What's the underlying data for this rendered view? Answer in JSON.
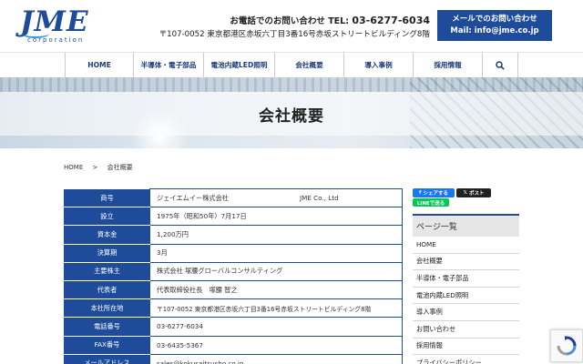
{
  "header": {
    "logo_text": "JME",
    "logo_sub": "corporation",
    "tel_label": "お電話でのお問い合わせ TEL: ",
    "tel_number": "03-6277-6034",
    "address": "〒107-0052 東京都港区赤坂六丁目3番16号赤坂ストリートビルディング8階",
    "mail_button_line1": "メールでのお問い合わせ",
    "mail_button_line2": "Mail: info@jme.co.jp"
  },
  "nav": {
    "items": [
      "HOME",
      "半導体・電子部品",
      "電池内蔵LED照明",
      "会社概要",
      "導入事例",
      "採用情報"
    ],
    "search_icon": "search-icon"
  },
  "hero": {
    "title": "会社概要"
  },
  "breadcrumb": {
    "home": "HOME",
    "separator": ">",
    "current": "会社概要"
  },
  "company_table": {
    "rows": [
      {
        "label": "商号",
        "value": "ジェイエムイー株式会社",
        "value_en": "JME Co., Ltd"
      },
      {
        "label": "設立",
        "value": "1975年（昭和50年）7月17日"
      },
      {
        "label": "資本金",
        "value": "1,200万円"
      },
      {
        "label": "決算期",
        "value": "3月"
      },
      {
        "label": "主要株主",
        "value": "株式会社 塚腰グローバルコンサルティング"
      },
      {
        "label": "代表者",
        "value": "代表取締役社長　塚腰 智之"
      },
      {
        "label": "本社所在地",
        "value": "〒107-0052 東京都港区赤坂六丁目3番16号赤坂ストリートビルディング8階"
      },
      {
        "label": "電話番号",
        "value": "03-6277-6034"
      },
      {
        "label": "FAX番号",
        "value": "03-6435-5367"
      },
      {
        "label": "メールアドレス",
        "value": "sales@kokusaitsusho.co.jp"
      }
    ]
  },
  "social": {
    "facebook_share": "シェアする",
    "x_post": "ポスト",
    "line_send": "LINEで送る"
  },
  "sidebar": {
    "title": "ページ一覧",
    "items": [
      "HOME",
      "会社概要",
      "半導体・電子部品",
      "電池内蔵LED照明",
      "導入事例",
      "お問い合わせ",
      "採用情報",
      "プライバシーポリシー"
    ]
  },
  "colors": {
    "brand_blue": "#1e4c9a",
    "facebook": "#1877f2",
    "line_green": "#06c755"
  }
}
